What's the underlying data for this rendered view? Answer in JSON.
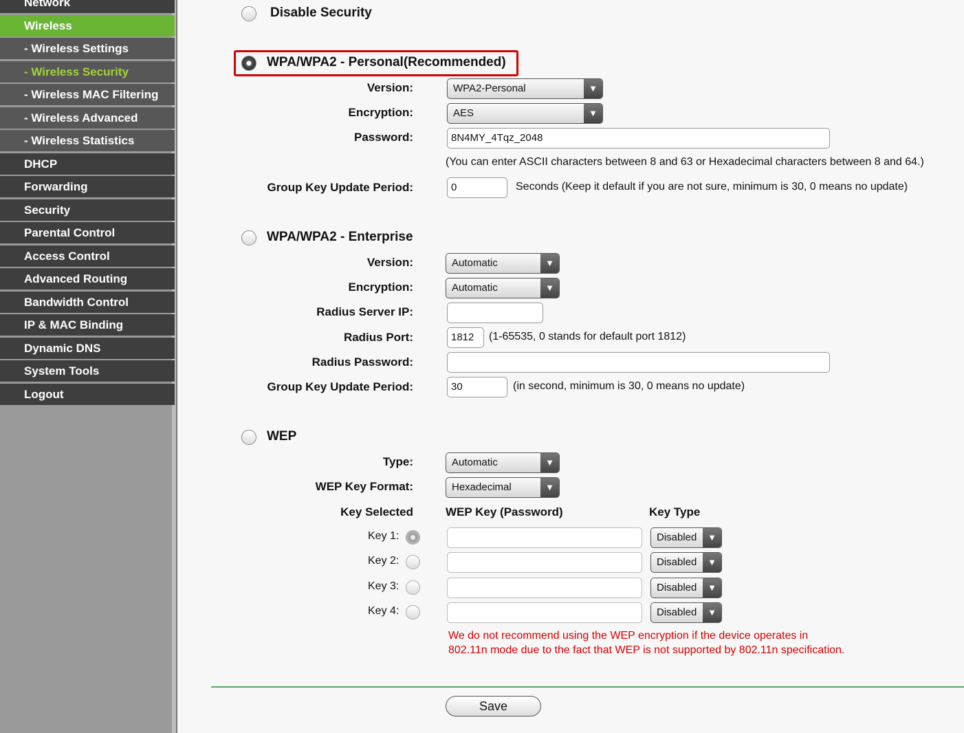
{
  "sidebar": {
    "items": [
      "Network",
      "Wireless",
      "- Wireless Settings",
      "- Wireless Security",
      "- Wireless MAC Filtering",
      "- Wireless Advanced",
      "- Wireless Statistics",
      "DHCP",
      "Forwarding",
      "Security",
      "Parental Control",
      "Access Control",
      "Advanced Routing",
      "Bandwidth Control",
      "IP & MAC Binding",
      "Dynamic DNS",
      "System Tools",
      "Logout"
    ]
  },
  "disable": {
    "label": "Disable Security"
  },
  "personal": {
    "label": "WPA/WPA2 - Personal(Recommended)",
    "version_label": "Version:",
    "version": "WPA2-Personal",
    "encryption_label": "Encryption:",
    "encryption": "AES",
    "password_label": "Password:",
    "password": "8N4MY_4Tqz_2048",
    "password_hint": "(You can enter ASCII characters between 8 and 63 or Hexadecimal characters between 8 and 64.)",
    "gkup_label": "Group Key Update Period:",
    "gkup": "0",
    "gkup_hint": "Seconds (Keep it default if you are not sure, minimum is 30, 0 means no update)"
  },
  "enterprise": {
    "label": "WPA/WPA2 - Enterprise",
    "version_label": "Version:",
    "version": "Automatic",
    "encryption_label": "Encryption:",
    "encryption": "Automatic",
    "radius_ip_label": "Radius Server IP:",
    "radius_ip": "",
    "radius_port_label": "Radius Port:",
    "radius_port": "1812",
    "radius_port_hint": "(1-65535, 0 stands for default port 1812)",
    "radius_pw_label": "Radius Password:",
    "radius_pw": "",
    "gkup_label": "Group Key Update Period:",
    "gkup": "30",
    "gkup_hint": "(in second, minimum is 30, 0 means no update)"
  },
  "wep": {
    "label": "WEP",
    "type_label": "Type:",
    "type": "Automatic",
    "format_label": "WEP Key Format:",
    "format": "Hexadecimal",
    "col_selected": "Key Selected",
    "col_key": "WEP Key (Password)",
    "col_type": "Key Type",
    "keys": [
      {
        "label": "Key 1:",
        "value": "",
        "type": "Disabled"
      },
      {
        "label": "Key 2:",
        "value": "",
        "type": "Disabled"
      },
      {
        "label": "Key 3:",
        "value": "",
        "type": "Disabled"
      },
      {
        "label": "Key 4:",
        "value": "",
        "type": "Disabled"
      }
    ],
    "warning1": "We do not recommend using the WEP encryption if the device operates in",
    "warning2": "802.11n mode due to the fact that WEP is not supported by 802.11n specification."
  },
  "save_label": "Save"
}
